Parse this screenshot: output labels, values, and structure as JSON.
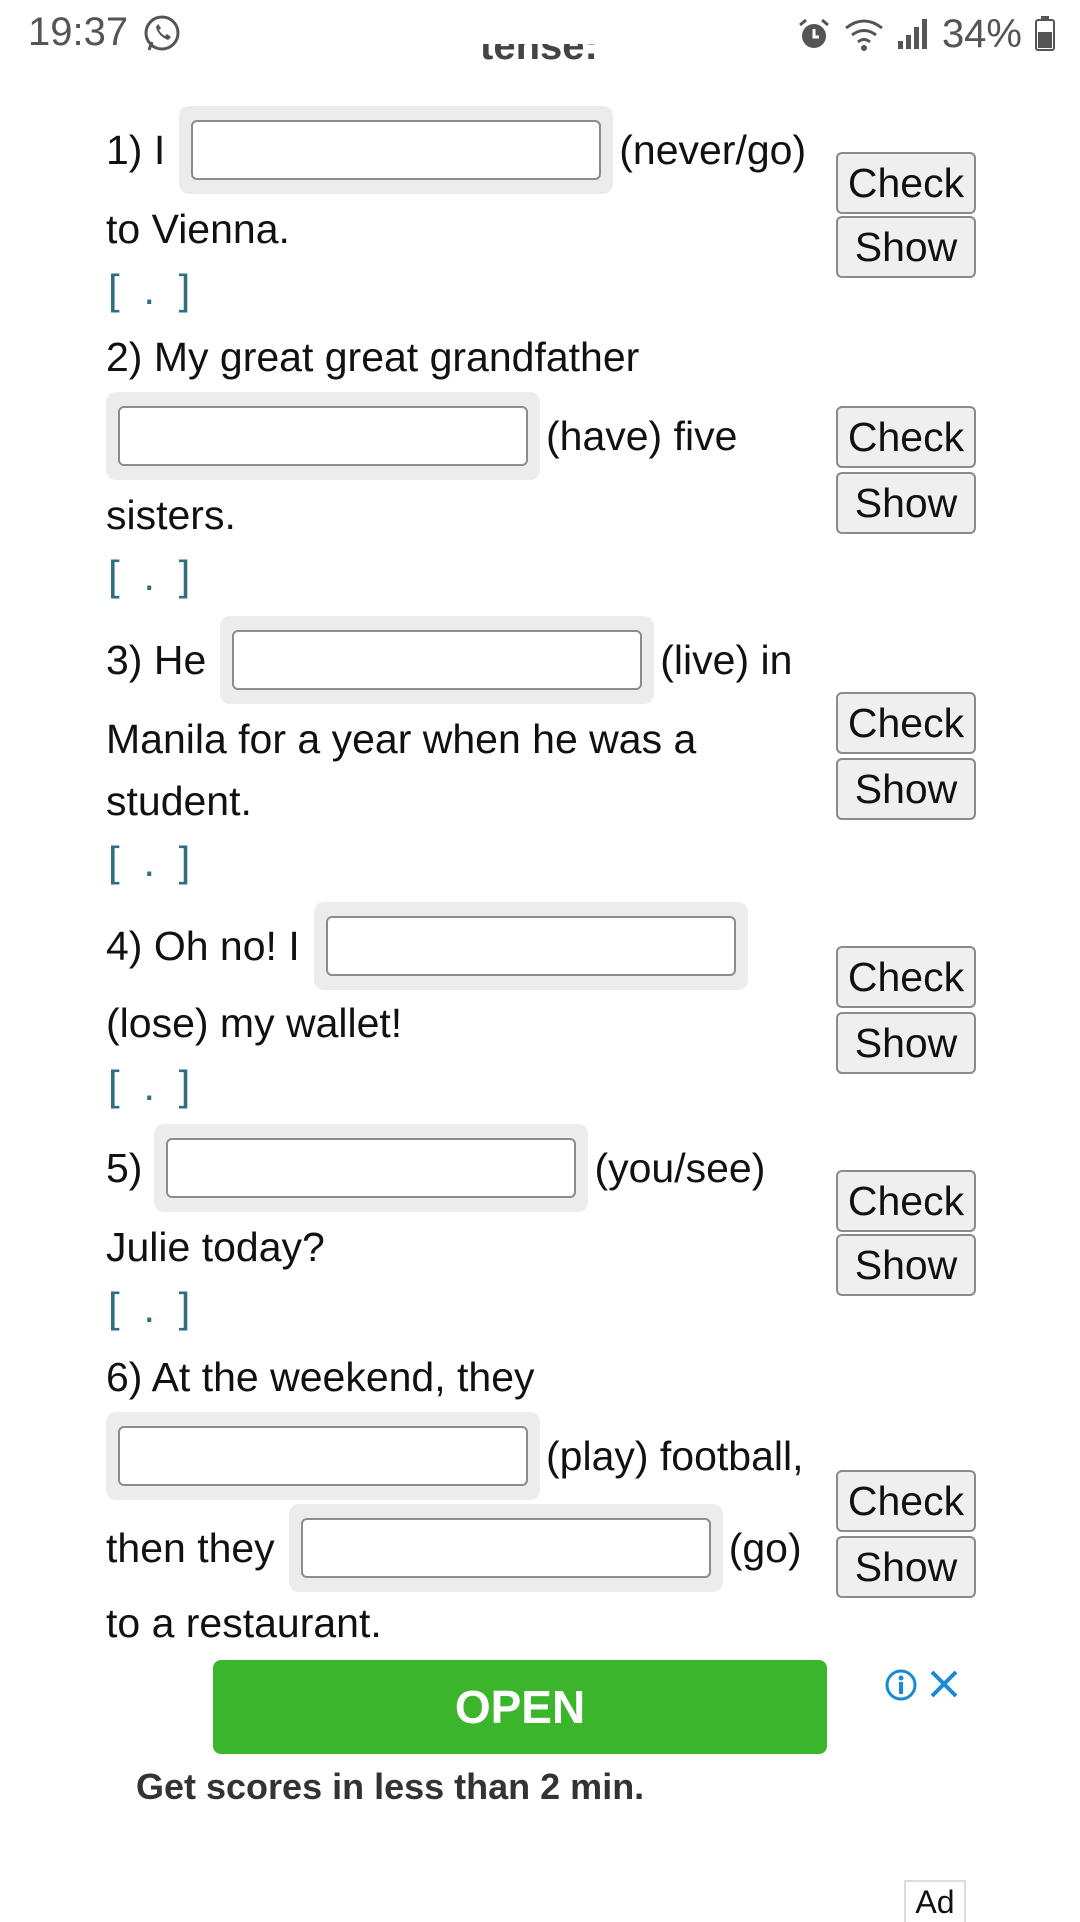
{
  "status_bar": {
    "time": "19:37",
    "battery": "34%"
  },
  "page": {
    "heading_cut": "tense:"
  },
  "buttons": {
    "check": "Check",
    "show": "Show"
  },
  "hint": "[ . ]",
  "exercises": [
    {
      "number": "1) I",
      "hint_before": "",
      "after_field": "(never/go)",
      "line2": "to Vienna.",
      "line3": ""
    },
    {
      "number": "2) My great great grandfather",
      "after_field": "(have) five",
      "line2": "sisters."
    },
    {
      "number": "3) He",
      "after_field": "(live) in",
      "line2": "Manila for a year when he was a",
      "line3": "student."
    },
    {
      "number": "4) Oh no! I",
      "after_field": "",
      "line2": "(lose) my wallet!"
    },
    {
      "number": "5)",
      "after_field": "(you/see)",
      "line2": "Julie today?"
    },
    {
      "number": "6) At the weekend, they",
      "after_field": "(play) football,",
      "line2_before": "then they",
      "line2_after": "(go)",
      "line3": "to a restaurant."
    }
  ],
  "ad": {
    "cta": "OPEN",
    "text": "Get scores in less than 2 min.",
    "tag": "Ad"
  }
}
